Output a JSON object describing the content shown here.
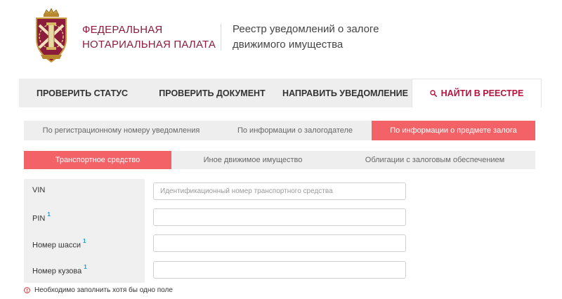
{
  "header": {
    "org_name_line1": "ФЕДЕРАЛЬНАЯ",
    "org_name_line2": "НОТАРИАЛЬНАЯ ПАЛАТА",
    "registry_title_line1": "Реестр уведомлений о залоге",
    "registry_title_line2": "движимого имущества"
  },
  "main_nav": {
    "items": [
      {
        "label": "ПРОВЕРИТЬ СТАТУС"
      },
      {
        "label": "ПРОВЕРИТЬ ДОКУМЕНТ"
      },
      {
        "label": "НАПРАВИТЬ УВЕДОМЛЕНИЕ"
      },
      {
        "label": "НАЙТИ В РЕЕСТРЕ",
        "active": true,
        "icon": "search-icon"
      }
    ]
  },
  "search_tabs": {
    "items": [
      {
        "label": "По регистрационному номеру уведомления"
      },
      {
        "label": "По информации о залогодателе"
      },
      {
        "label": "По информации о предмете залога",
        "active": true
      }
    ]
  },
  "property_tabs": {
    "items": [
      {
        "label": "Транспортное средство",
        "active": true
      },
      {
        "label": "Иное движимое имущество"
      },
      {
        "label": "Облигации с залоговым обеспечением"
      }
    ]
  },
  "form": {
    "vin_label": "VIN",
    "vin_placeholder": "Идентификационный номер транспортного средства",
    "vin_value": "",
    "pin_label": "PIN",
    "pin_value": "",
    "chassis_label": "Номер шасси",
    "chassis_value": "",
    "body_label": "Номер кузова",
    "body_value": "",
    "footnote_mark": "1"
  },
  "hint": {
    "text": "Необходимо заполнить хотя бы одно поле",
    "icon": "info-circle-icon"
  },
  "colors": {
    "brand": "#8c1c3c",
    "accent": "#f26267",
    "active_nav_text": "#b5123e",
    "footnote": "#1a9bd7",
    "hint_icon": "#d9363e"
  }
}
